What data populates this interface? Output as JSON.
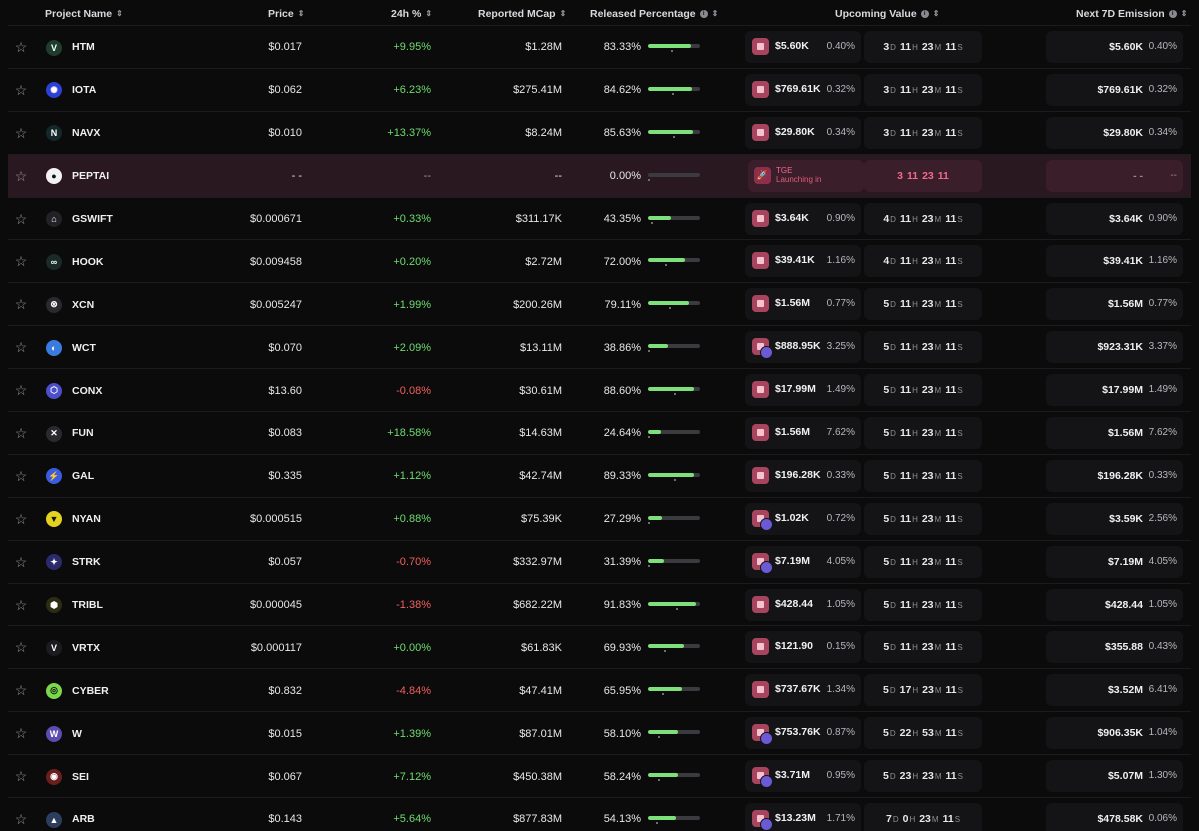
{
  "headers": {
    "project_name": "Project Name",
    "price": "Price",
    "change": "24h %",
    "mcap": "Reported MCap",
    "released": "Released Percentage",
    "upcoming": "Upcoming Value",
    "next7d": "Next 7D Emission"
  },
  "icons": {
    "star": "star-outline-icon",
    "sort": "sort-arrows-icon",
    "info": "info-icon"
  },
  "colors": {
    "up": "#6fdc6f",
    "down": "#f25f5c",
    "accent_pink": "#f06b8b",
    "bar_fill": "#7ee07b"
  },
  "rows": [
    {
      "name": "HTM",
      "price": "$0.017",
      "change": "+9.95%",
      "dir": "up",
      "mcap": "$1.28M",
      "released": "83.33%",
      "released_frac": 0.8333,
      "upc_val": "$5.60K",
      "upc_pct": "0.40%",
      "dual": false,
      "cd": [
        "3",
        "11",
        "23",
        "11"
      ],
      "next_val": "$5.60K",
      "next_pct": "0.40%",
      "logo_bg": "#1f3d2f",
      "logo": "V"
    },
    {
      "name": "IOTA",
      "price": "$0.062",
      "change": "+6.23%",
      "dir": "up",
      "mcap": "$275.41M",
      "released": "84.62%",
      "released_frac": 0.8462,
      "upc_val": "$769.61K",
      "upc_pct": "0.32%",
      "dual": false,
      "cd": [
        "3",
        "11",
        "23",
        "11"
      ],
      "next_val": "$769.61K",
      "next_pct": "0.32%",
      "logo_bg": "#2e3fd6",
      "logo": "✺"
    },
    {
      "name": "NAVX",
      "price": "$0.010",
      "change": "+13.37%",
      "dir": "up",
      "mcap": "$8.24M",
      "released": "85.63%",
      "released_frac": 0.8563,
      "upc_val": "$29.80K",
      "upc_pct": "0.34%",
      "dual": false,
      "cd": [
        "3",
        "11",
        "23",
        "11"
      ],
      "next_val": "$29.80K",
      "next_pct": "0.34%",
      "logo_bg": "#14272a",
      "logo": "N"
    },
    {
      "name": "PEPTAI",
      "price": "- -",
      "change": "--",
      "dir": "flat",
      "mcap": "--",
      "released": "0.00%",
      "released_frac": 0,
      "tge": true,
      "tge_title": "TGE",
      "tge_sub": "Launching in",
      "cd": [
        "3",
        "11",
        "23",
        "11"
      ],
      "next_val": "- -",
      "next_pct": "--",
      "logo_bg": "#f2f2f2",
      "logo": "●"
    },
    {
      "name": "GSWIFT",
      "price": "$0.000671",
      "change": "+0.33%",
      "dir": "up",
      "mcap": "$311.17K",
      "released": "43.35%",
      "released_frac": 0.4335,
      "upc_val": "$3.64K",
      "upc_pct": "0.90%",
      "dual": false,
      "cd": [
        "4",
        "11",
        "23",
        "11"
      ],
      "next_val": "$3.64K",
      "next_pct": "0.90%",
      "logo_bg": "#222226",
      "logo": "⌂"
    },
    {
      "name": "HOOK",
      "price": "$0.009458",
      "change": "+0.20%",
      "dir": "up",
      "mcap": "$2.72M",
      "released": "72.00%",
      "released_frac": 0.72,
      "upc_val": "$39.41K",
      "upc_pct": "1.16%",
      "dual": false,
      "cd": [
        "4",
        "11",
        "23",
        "11"
      ],
      "next_val": "$39.41K",
      "next_pct": "1.16%",
      "logo_bg": "#1a2a26",
      "logo": "∞"
    },
    {
      "name": "XCN",
      "price": "$0.005247",
      "change": "+1.99%",
      "dir": "up",
      "mcap": "$200.26M",
      "released": "79.11%",
      "released_frac": 0.7911,
      "upc_val": "$1.56M",
      "upc_pct": "0.77%",
      "dual": false,
      "cd": [
        "5",
        "11",
        "23",
        "11"
      ],
      "next_val": "$1.56M",
      "next_pct": "0.77%",
      "logo_bg": "#2a2a2e",
      "logo": "⊗"
    },
    {
      "name": "WCT",
      "price": "$0.070",
      "change": "+2.09%",
      "dir": "up",
      "mcap": "$13.11M",
      "released": "38.86%",
      "released_frac": 0.3886,
      "upc_val": "$888.95K",
      "upc_pct": "3.25%",
      "dual": true,
      "cd": [
        "5",
        "11",
        "23",
        "11"
      ],
      "next_val": "$923.31K",
      "next_pct": "3.37%",
      "logo_bg": "#3a7be0",
      "logo": "◐"
    },
    {
      "name": "CONX",
      "price": "$13.60",
      "change": "-0.08%",
      "dir": "down",
      "mcap": "$30.61M",
      "released": "88.60%",
      "released_frac": 0.886,
      "upc_val": "$17.99M",
      "upc_pct": "1.49%",
      "dual": false,
      "cd": [
        "5",
        "11",
        "23",
        "11"
      ],
      "next_val": "$17.99M",
      "next_pct": "1.49%",
      "logo_bg": "#4b4fc9",
      "logo": "⬡"
    },
    {
      "name": "FUN",
      "price": "$0.083",
      "change": "+18.58%",
      "dir": "up",
      "mcap": "$14.63M",
      "released": "24.64%",
      "released_frac": 0.2464,
      "upc_val": "$1.56M",
      "upc_pct": "7.62%",
      "dual": false,
      "cd": [
        "5",
        "11",
        "23",
        "11"
      ],
      "next_val": "$1.56M",
      "next_pct": "7.62%",
      "logo_bg": "#2a2a2e",
      "logo": "✕"
    },
    {
      "name": "GAL",
      "price": "$0.335",
      "change": "+1.12%",
      "dir": "up",
      "mcap": "$42.74M",
      "released": "89.33%",
      "released_frac": 0.8933,
      "upc_val": "$196.28K",
      "upc_pct": "0.33%",
      "dual": false,
      "cd": [
        "5",
        "11",
        "23",
        "11"
      ],
      "next_val": "$196.28K",
      "next_pct": "0.33%",
      "logo_bg": "#3b5ce0",
      "logo": "⚡"
    },
    {
      "name": "NYAN",
      "price": "$0.000515",
      "change": "+0.88%",
      "dir": "up",
      "mcap": "$75.39K",
      "released": "27.29%",
      "released_frac": 0.2729,
      "upc_val": "$1.02K",
      "upc_pct": "0.72%",
      "dual": true,
      "cd": [
        "5",
        "11",
        "23",
        "11"
      ],
      "next_val": "$3.59K",
      "next_pct": "2.56%",
      "logo_bg": "#e3d21f",
      "logo": "▼"
    },
    {
      "name": "STRK",
      "price": "$0.057",
      "change": "-0.70%",
      "dir": "down",
      "mcap": "$332.97M",
      "released": "31.39%",
      "released_frac": 0.3139,
      "upc_val": "$7.19M",
      "upc_pct": "4.05%",
      "dual": true,
      "cd": [
        "5",
        "11",
        "23",
        "11"
      ],
      "next_val": "$7.19M",
      "next_pct": "4.05%",
      "logo_bg": "#2b2a6b",
      "logo": "✦"
    },
    {
      "name": "TRIBL",
      "price": "$0.000045",
      "change": "-1.38%",
      "dir": "down",
      "mcap": "$682.22M",
      "released": "91.83%",
      "released_frac": 0.9183,
      "upc_val": "$428.44",
      "upc_pct": "1.05%",
      "dual": false,
      "cd": [
        "5",
        "11",
        "23",
        "11"
      ],
      "next_val": "$428.44",
      "next_pct": "1.05%",
      "logo_bg": "#2c2d14",
      "logo": "⬢"
    },
    {
      "name": "VRTX",
      "price": "$0.000117",
      "change": "+0.00%",
      "dir": "up",
      "mcap": "$61.83K",
      "released": "69.93%",
      "released_frac": 0.6993,
      "upc_val": "$121.90",
      "upc_pct": "0.15%",
      "dual": false,
      "cd": [
        "5",
        "11",
        "23",
        "11"
      ],
      "next_val": "$355.88",
      "next_pct": "0.43%",
      "logo_bg": "#1c1c20",
      "logo": "V"
    },
    {
      "name": "CYBER",
      "price": "$0.832",
      "change": "-4.84%",
      "dir": "down",
      "mcap": "$47.41M",
      "released": "65.95%",
      "released_frac": 0.6595,
      "upc_val": "$737.67K",
      "upc_pct": "1.34%",
      "dual": false,
      "cd": [
        "5",
        "17",
        "23",
        "11"
      ],
      "next_val": "$3.52M",
      "next_pct": "6.41%",
      "logo_bg": "#7ad94a",
      "logo": "◎"
    },
    {
      "name": "W",
      "price": "$0.015",
      "change": "+1.39%",
      "dir": "up",
      "mcap": "$87.01M",
      "released": "58.10%",
      "released_frac": 0.581,
      "upc_val": "$753.76K",
      "upc_pct": "0.87%",
      "dual": true,
      "cd": [
        "5",
        "22",
        "53",
        "11"
      ],
      "next_val": "$906.35K",
      "next_pct": "1.04%",
      "logo_bg": "#5d4bb0",
      "logo": "W"
    },
    {
      "name": "SEI",
      "price": "$0.067",
      "change": "+7.12%",
      "dir": "up",
      "mcap": "$450.38M",
      "released": "58.24%",
      "released_frac": 0.5824,
      "upc_val": "$3.71M",
      "upc_pct": "0.95%",
      "dual": true,
      "cd": [
        "5",
        "23",
        "23",
        "11"
      ],
      "next_val": "$5.07M",
      "next_pct": "1.30%",
      "logo_bg": "#6a1f1f",
      "logo": "◉"
    },
    {
      "name": "ARB",
      "price": "$0.143",
      "change": "+5.64%",
      "dir": "up",
      "mcap": "$877.83M",
      "released": "54.13%",
      "released_frac": 0.5413,
      "upc_val": "$13.23M",
      "upc_pct": "1.71%",
      "dual": true,
      "cd": [
        "7",
        "0",
        "23",
        "11"
      ],
      "next_val": "$478.58K",
      "next_pct": "0.06%",
      "logo_bg": "#2c3e5e",
      "logo": "▲"
    }
  ],
  "units": [
    "D",
    "H",
    "M",
    "S"
  ]
}
